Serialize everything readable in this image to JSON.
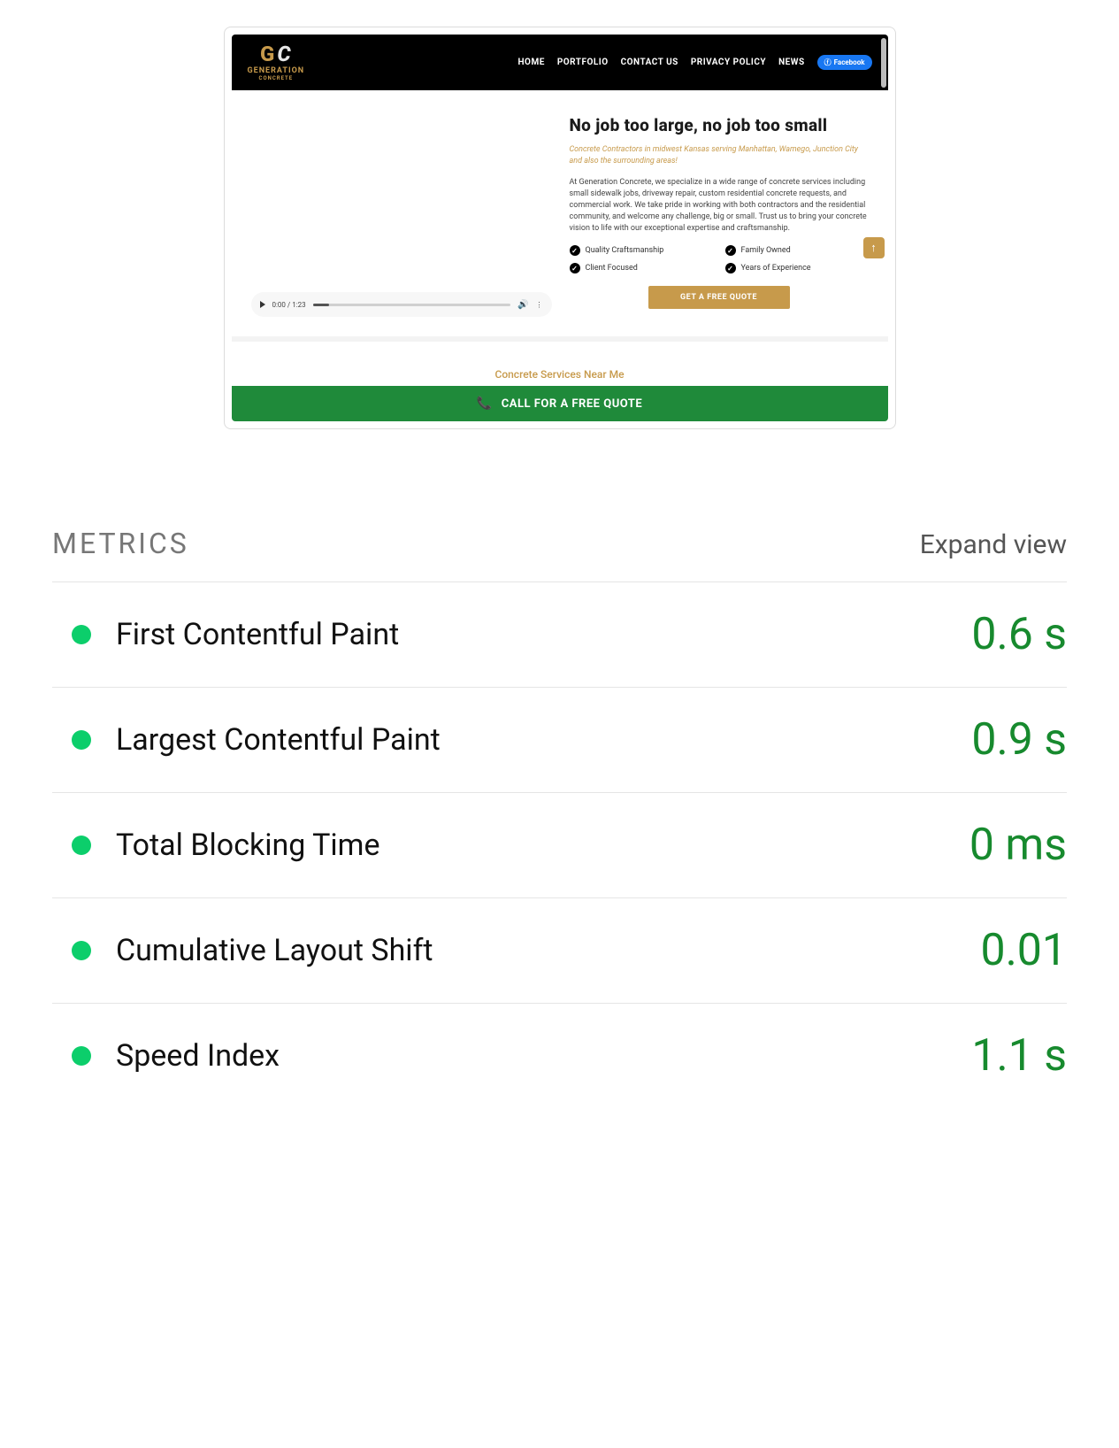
{
  "preview": {
    "logo_text": "GENERATION",
    "logo_sub": "CONCRETE",
    "nav": {
      "home": "HOME",
      "portfolio": "PORTFOLIO",
      "contact": "CONTACT US",
      "privacy": "PRIVACY POLICY",
      "news": "NEWS",
      "facebook": "Facebook"
    },
    "video": {
      "time": "0:00 / 1:23",
      "vol_icon": "🔊",
      "menu_icon": "⋮"
    },
    "hero": {
      "title": "No job too large, no job too small",
      "tagline": "Concrete Contractors in midwest Kansas serving Manhattan, Wamego, Junction City and also the surrounding areas!",
      "desc": "At Generation Concrete, we specialize in a wide range of concrete services including small sidewalk jobs, driveway repair, custom residential concrete requests, and commercial work. We take pride in working with both contractors and the residential community, and welcome any challenge, big or small. Trust us to bring your concrete vision to life with our exceptional expertise and craftsmanship.",
      "features": [
        "Quality Craftsmanship",
        "Family Owned",
        "Client Focused",
        "Years of Experience"
      ],
      "quote_btn": "GET A FREE QUOTE",
      "arrow": "↑"
    },
    "near_me": "Concrete Services Near Me",
    "call_bar": "CALL FOR A FREE QUOTE"
  },
  "metrics_section": {
    "title": "METRICS",
    "expand": "Expand view",
    "rows": [
      {
        "label": "First Contentful Paint",
        "value": "0.6 s"
      },
      {
        "label": "Largest Contentful Paint",
        "value": "0.9 s"
      },
      {
        "label": "Total Blocking Time",
        "value": "0 ms"
      },
      {
        "label": "Cumulative Layout Shift",
        "value": "0.01"
      },
      {
        "label": "Speed Index",
        "value": "1.1 s"
      }
    ]
  }
}
